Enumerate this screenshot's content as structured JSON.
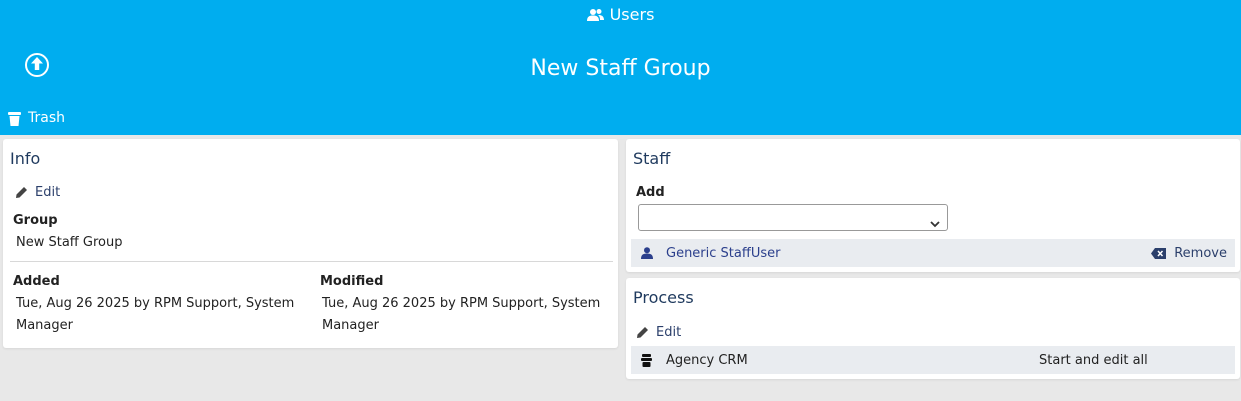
{
  "header": {
    "users_link": "Users",
    "title": "New Staff Group",
    "trash_label": "Trash",
    "background": "#00adef"
  },
  "info": {
    "title": "Info",
    "edit_label": "Edit",
    "group_label": "Group",
    "group_value": "New Staff Group",
    "added_label": "Added",
    "added_value": "Tue, Aug 26 2025 by RPM Support, System Manager",
    "modified_label": "Modified",
    "modified_value": "Tue, Aug 26 2025 by RPM Support, System Manager"
  },
  "staff": {
    "title": "Staff",
    "add_label": "Add",
    "add_value": "",
    "members": [
      {
        "name": "Generic StaffUser",
        "action": "Remove"
      }
    ]
  },
  "process": {
    "title": "Process",
    "edit_label": "Edit",
    "items": [
      {
        "name": "Agency CRM",
        "permission": "Start and edit all"
      }
    ]
  }
}
